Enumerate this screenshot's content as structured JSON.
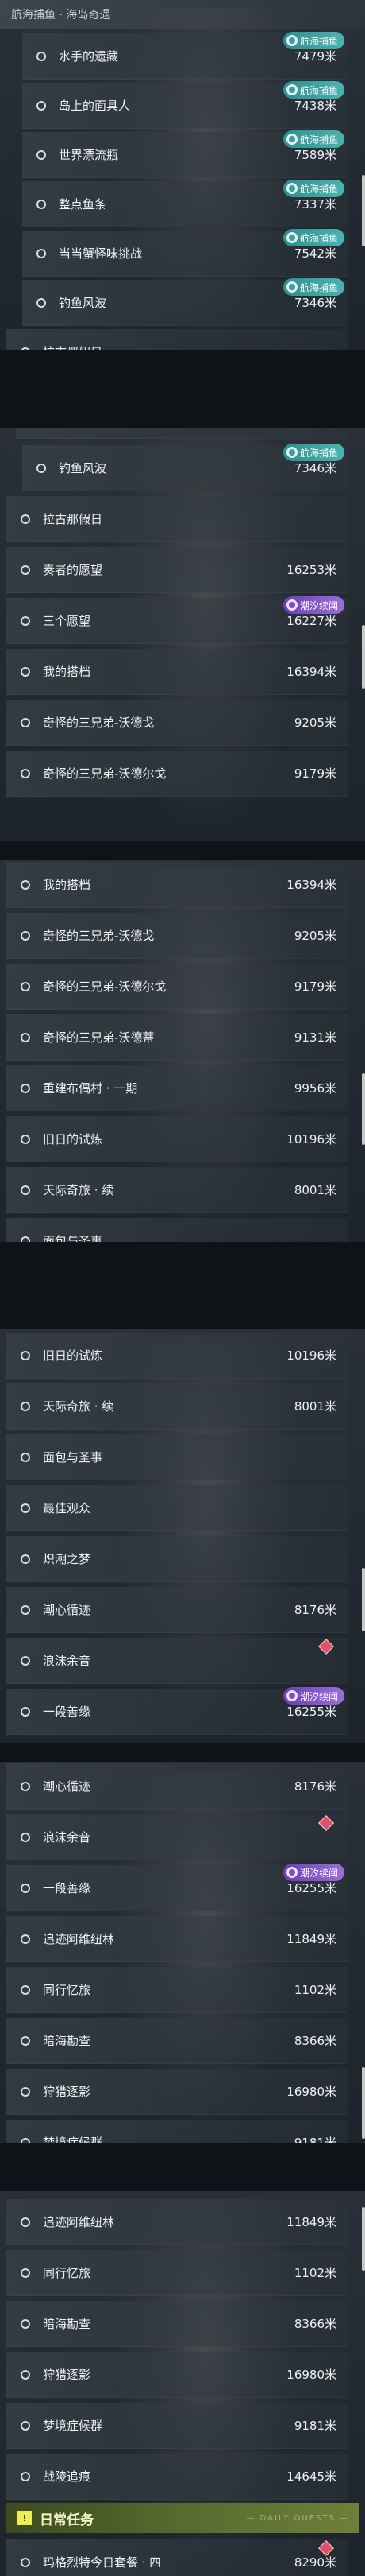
{
  "section_title": "航海捕鱼 · 海岛奇遇",
  "badges": {
    "sea": "航海捕鱼",
    "tide": "潮汐续闻"
  },
  "marker_icon": "diamond-marker-icon",
  "items": {
    "shuishou": {
      "label": "水手的遗藏",
      "dist": "7479米"
    },
    "daoshang": {
      "label": "岛上的面具人",
      "dist": "7438米"
    },
    "shijie": {
      "label": "世界漂流瓶",
      "dist": "7589米"
    },
    "zhengdian": {
      "label": "整点鱼条",
      "dist": "7337米"
    },
    "dangdang": {
      "label": "当当蟹怪味挑战",
      "dist": "7542米"
    },
    "diaoyu": {
      "label": "钓鱼风波",
      "dist": "7346米"
    },
    "lagu": {
      "label": "拉古那假日",
      "dist": ""
    },
    "zouzhe": {
      "label": "奏者的愿望",
      "dist": "16253米"
    },
    "sange": {
      "label": "三个愿望",
      "dist": "16227米"
    },
    "dapei": {
      "label": "我的搭档",
      "dist": "16394米"
    },
    "wode": {
      "label": "奇怪的三兄弟-沃德戈",
      "dist": "9205米"
    },
    "woder": {
      "label": "奇怪的三兄弟-沃德尔戈",
      "dist": "9179米"
    },
    "wodedi": {
      "label": "奇怪的三兄弟-沃德蒂",
      "dist": "9131米"
    },
    "chongjian": {
      "label": "重建布偶村 · 一期",
      "dist": "9956米"
    },
    "jiuri": {
      "label": "旧日的试炼",
      "dist": "10196米"
    },
    "tianji": {
      "label": "天际奇旅 · 续",
      "dist": "8001米"
    },
    "mianbao": {
      "label": "面包与圣事",
      "dist": ""
    },
    "zuijia": {
      "label": "最佳观众",
      "dist": ""
    },
    "chizhu": {
      "label": "炽潮之梦",
      "dist": ""
    },
    "chaoxin": {
      "label": "潮心循迹",
      "dist": "8176米"
    },
    "langmo": {
      "label": "浪沫余音",
      "dist": ""
    },
    "yiduan": {
      "label": "一段善缘",
      "dist": "16255米"
    },
    "zhuiji": {
      "label": "追迹阿维纽林",
      "dist": "11849米"
    },
    "tongxing": {
      "label": "同行忆旅",
      "dist": "1102米"
    },
    "anhai": {
      "label": "暗海勘查",
      "dist": "8366米"
    },
    "shoulie": {
      "label": "狩猎逐影",
      "dist": "16980米"
    },
    "mengjing": {
      "label": "梦境症候群",
      "dist": "9181米"
    },
    "zhandou": {
      "label": "战陵追痕",
      "dist": "14645米"
    },
    "mage": {
      "label": "玛格烈特今日套餐 · 四",
      "dist": "8290米"
    }
  },
  "daily": {
    "title": "日常任务",
    "deco": "— DAILY QUESTS —"
  }
}
